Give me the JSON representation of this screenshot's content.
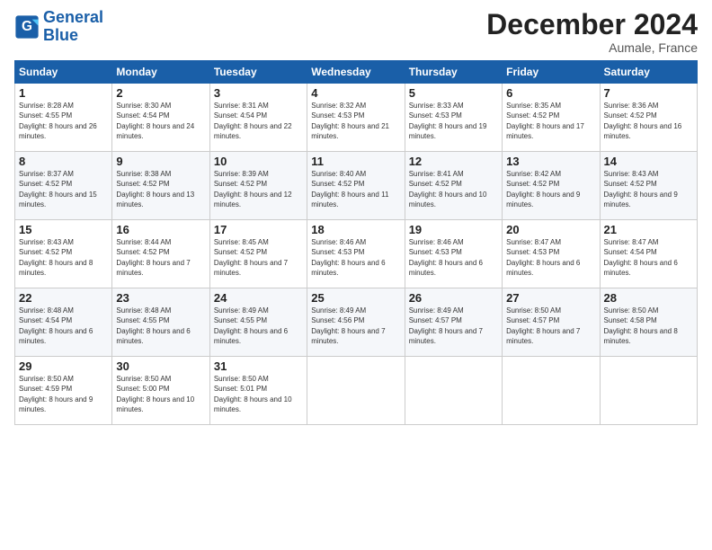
{
  "logo": {
    "line1": "General",
    "line2": "Blue"
  },
  "title": "December 2024",
  "subtitle": "Aumale, France",
  "days_header": [
    "Sunday",
    "Monday",
    "Tuesday",
    "Wednesday",
    "Thursday",
    "Friday",
    "Saturday"
  ],
  "weeks": [
    [
      {
        "num": "1",
        "sunrise": "Sunrise: 8:28 AM",
        "sunset": "Sunset: 4:55 PM",
        "daylight": "Daylight: 8 hours and 26 minutes."
      },
      {
        "num": "2",
        "sunrise": "Sunrise: 8:30 AM",
        "sunset": "Sunset: 4:54 PM",
        "daylight": "Daylight: 8 hours and 24 minutes."
      },
      {
        "num": "3",
        "sunrise": "Sunrise: 8:31 AM",
        "sunset": "Sunset: 4:54 PM",
        "daylight": "Daylight: 8 hours and 22 minutes."
      },
      {
        "num": "4",
        "sunrise": "Sunrise: 8:32 AM",
        "sunset": "Sunset: 4:53 PM",
        "daylight": "Daylight: 8 hours and 21 minutes."
      },
      {
        "num": "5",
        "sunrise": "Sunrise: 8:33 AM",
        "sunset": "Sunset: 4:53 PM",
        "daylight": "Daylight: 8 hours and 19 minutes."
      },
      {
        "num": "6",
        "sunrise": "Sunrise: 8:35 AM",
        "sunset": "Sunset: 4:52 PM",
        "daylight": "Daylight: 8 hours and 17 minutes."
      },
      {
        "num": "7",
        "sunrise": "Sunrise: 8:36 AM",
        "sunset": "Sunset: 4:52 PM",
        "daylight": "Daylight: 8 hours and 16 minutes."
      }
    ],
    [
      {
        "num": "8",
        "sunrise": "Sunrise: 8:37 AM",
        "sunset": "Sunset: 4:52 PM",
        "daylight": "Daylight: 8 hours and 15 minutes."
      },
      {
        "num": "9",
        "sunrise": "Sunrise: 8:38 AM",
        "sunset": "Sunset: 4:52 PM",
        "daylight": "Daylight: 8 hours and 13 minutes."
      },
      {
        "num": "10",
        "sunrise": "Sunrise: 8:39 AM",
        "sunset": "Sunset: 4:52 PM",
        "daylight": "Daylight: 8 hours and 12 minutes."
      },
      {
        "num": "11",
        "sunrise": "Sunrise: 8:40 AM",
        "sunset": "Sunset: 4:52 PM",
        "daylight": "Daylight: 8 hours and 11 minutes."
      },
      {
        "num": "12",
        "sunrise": "Sunrise: 8:41 AM",
        "sunset": "Sunset: 4:52 PM",
        "daylight": "Daylight: 8 hours and 10 minutes."
      },
      {
        "num": "13",
        "sunrise": "Sunrise: 8:42 AM",
        "sunset": "Sunset: 4:52 PM",
        "daylight": "Daylight: 8 hours and 9 minutes."
      },
      {
        "num": "14",
        "sunrise": "Sunrise: 8:43 AM",
        "sunset": "Sunset: 4:52 PM",
        "daylight": "Daylight: 8 hours and 9 minutes."
      }
    ],
    [
      {
        "num": "15",
        "sunrise": "Sunrise: 8:43 AM",
        "sunset": "Sunset: 4:52 PM",
        "daylight": "Daylight: 8 hours and 8 minutes."
      },
      {
        "num": "16",
        "sunrise": "Sunrise: 8:44 AM",
        "sunset": "Sunset: 4:52 PM",
        "daylight": "Daylight: 8 hours and 7 minutes."
      },
      {
        "num": "17",
        "sunrise": "Sunrise: 8:45 AM",
        "sunset": "Sunset: 4:52 PM",
        "daylight": "Daylight: 8 hours and 7 minutes."
      },
      {
        "num": "18",
        "sunrise": "Sunrise: 8:46 AM",
        "sunset": "Sunset: 4:53 PM",
        "daylight": "Daylight: 8 hours and 6 minutes."
      },
      {
        "num": "19",
        "sunrise": "Sunrise: 8:46 AM",
        "sunset": "Sunset: 4:53 PM",
        "daylight": "Daylight: 8 hours and 6 minutes."
      },
      {
        "num": "20",
        "sunrise": "Sunrise: 8:47 AM",
        "sunset": "Sunset: 4:53 PM",
        "daylight": "Daylight: 8 hours and 6 minutes."
      },
      {
        "num": "21",
        "sunrise": "Sunrise: 8:47 AM",
        "sunset": "Sunset: 4:54 PM",
        "daylight": "Daylight: 8 hours and 6 minutes."
      }
    ],
    [
      {
        "num": "22",
        "sunrise": "Sunrise: 8:48 AM",
        "sunset": "Sunset: 4:54 PM",
        "daylight": "Daylight: 8 hours and 6 minutes."
      },
      {
        "num": "23",
        "sunrise": "Sunrise: 8:48 AM",
        "sunset": "Sunset: 4:55 PM",
        "daylight": "Daylight: 8 hours and 6 minutes."
      },
      {
        "num": "24",
        "sunrise": "Sunrise: 8:49 AM",
        "sunset": "Sunset: 4:55 PM",
        "daylight": "Daylight: 8 hours and 6 minutes."
      },
      {
        "num": "25",
        "sunrise": "Sunrise: 8:49 AM",
        "sunset": "Sunset: 4:56 PM",
        "daylight": "Daylight: 8 hours and 7 minutes."
      },
      {
        "num": "26",
        "sunrise": "Sunrise: 8:49 AM",
        "sunset": "Sunset: 4:57 PM",
        "daylight": "Daylight: 8 hours and 7 minutes."
      },
      {
        "num": "27",
        "sunrise": "Sunrise: 8:50 AM",
        "sunset": "Sunset: 4:57 PM",
        "daylight": "Daylight: 8 hours and 7 minutes."
      },
      {
        "num": "28",
        "sunrise": "Sunrise: 8:50 AM",
        "sunset": "Sunset: 4:58 PM",
        "daylight": "Daylight: 8 hours and 8 minutes."
      }
    ],
    [
      {
        "num": "29",
        "sunrise": "Sunrise: 8:50 AM",
        "sunset": "Sunset: 4:59 PM",
        "daylight": "Daylight: 8 hours and 9 minutes."
      },
      {
        "num": "30",
        "sunrise": "Sunrise: 8:50 AM",
        "sunset": "Sunset: 5:00 PM",
        "daylight": "Daylight: 8 hours and 10 minutes."
      },
      {
        "num": "31",
        "sunrise": "Sunrise: 8:50 AM",
        "sunset": "Sunset: 5:01 PM",
        "daylight": "Daylight: 8 hours and 10 minutes."
      },
      null,
      null,
      null,
      null
    ]
  ]
}
